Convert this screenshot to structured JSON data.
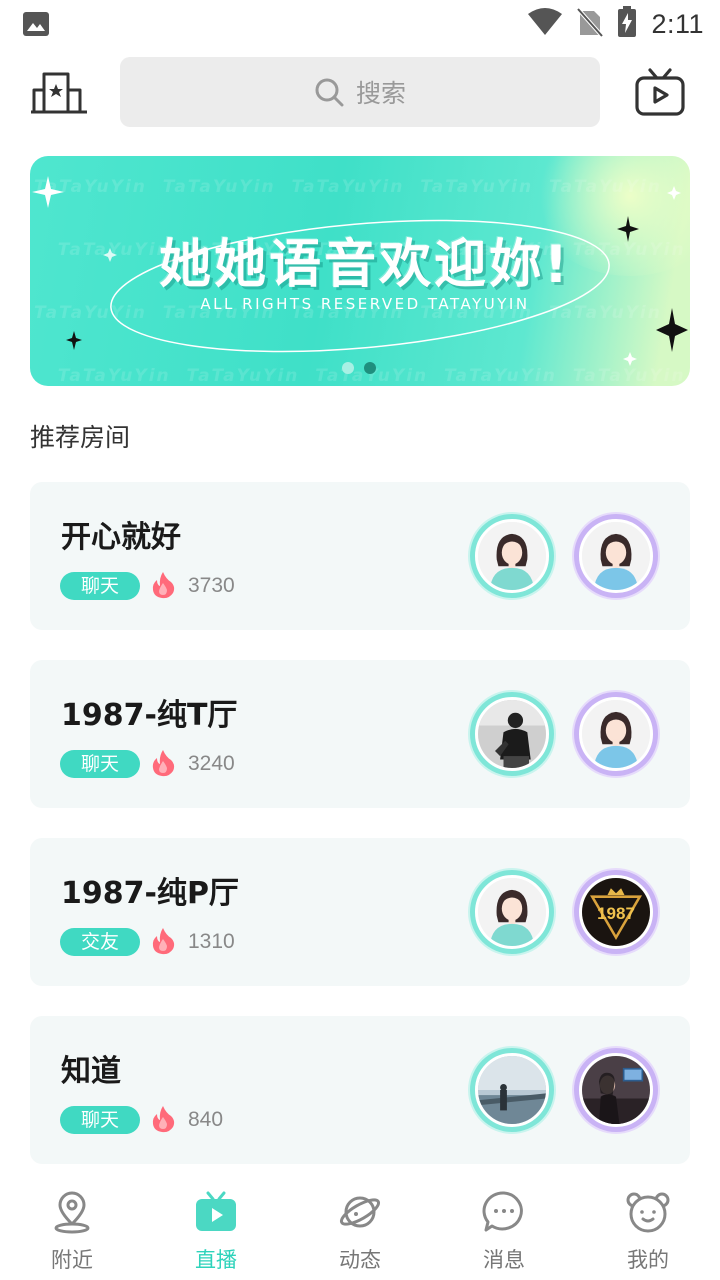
{
  "status_bar": {
    "time": "2:11"
  },
  "search": {
    "placeholder": "搜索"
  },
  "banner": {
    "title": "她她语音欢迎妳!",
    "subtitle": "ALL RIGHTS RESERVED TATAYUYIN",
    "watermark": "TaTaYuYin",
    "page_count": 2,
    "active_page": 2
  },
  "section": {
    "title": "推荐房间"
  },
  "rooms": [
    {
      "name": "开心就好",
      "tag": "聊天",
      "heat": "3730",
      "avatars": [
        "girl-default",
        "girl-default"
      ]
    },
    {
      "name": "1987-纯T厅",
      "tag": "聊天",
      "heat": "3240",
      "avatars": [
        "photo-man",
        "girl-default"
      ]
    },
    {
      "name": "1987-纯P厅",
      "tag": "交友",
      "heat": "1310",
      "avatars": [
        "girl-default",
        "logo-1987"
      ]
    },
    {
      "name": "知道",
      "tag": "聊天",
      "heat": "840",
      "avatars": [
        "photo-seaside",
        "photo-room"
      ]
    }
  ],
  "avatar_logo_text": "1987",
  "nav": [
    {
      "label": "附近",
      "icon": "location-pin-icon",
      "active": false
    },
    {
      "label": "直播",
      "icon": "tv-play-icon",
      "active": true
    },
    {
      "label": "动态",
      "icon": "planet-icon",
      "active": false
    },
    {
      "label": "消息",
      "icon": "chat-bubble-icon",
      "active": false
    },
    {
      "label": "我的",
      "icon": "bear-face-icon",
      "active": false
    }
  ],
  "colors": {
    "accent": "#2fd3bb",
    "tag_bg": "#40d9c2",
    "card_bg": "#f3f8f8",
    "banner": "#3fe0c8"
  }
}
